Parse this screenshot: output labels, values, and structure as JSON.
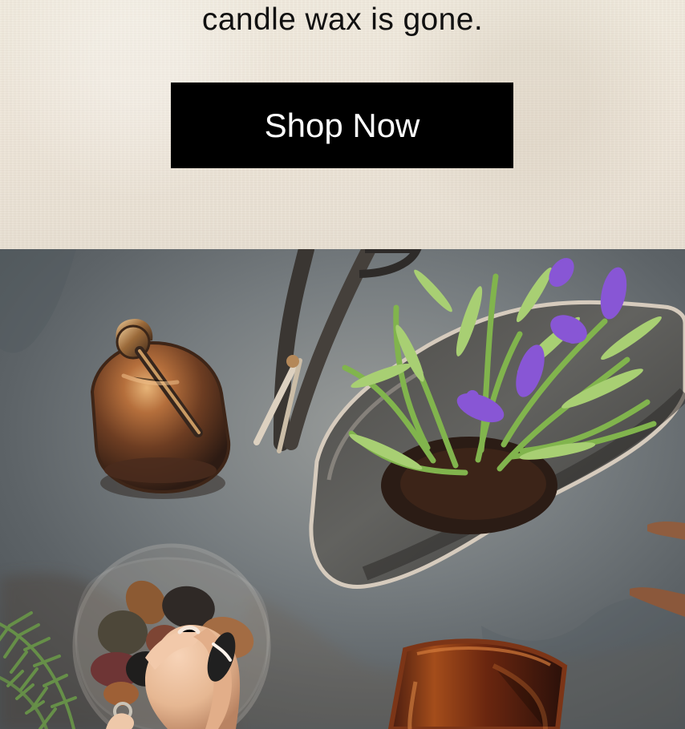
{
  "promo": {
    "tagline": "candle wax is gone.",
    "cta_label": "Shop Now"
  },
  "colors": {
    "button_background": "#000000",
    "button_text": "#ffffff",
    "tagline_text": "#111111",
    "linen_background": "#efe8dc"
  }
}
